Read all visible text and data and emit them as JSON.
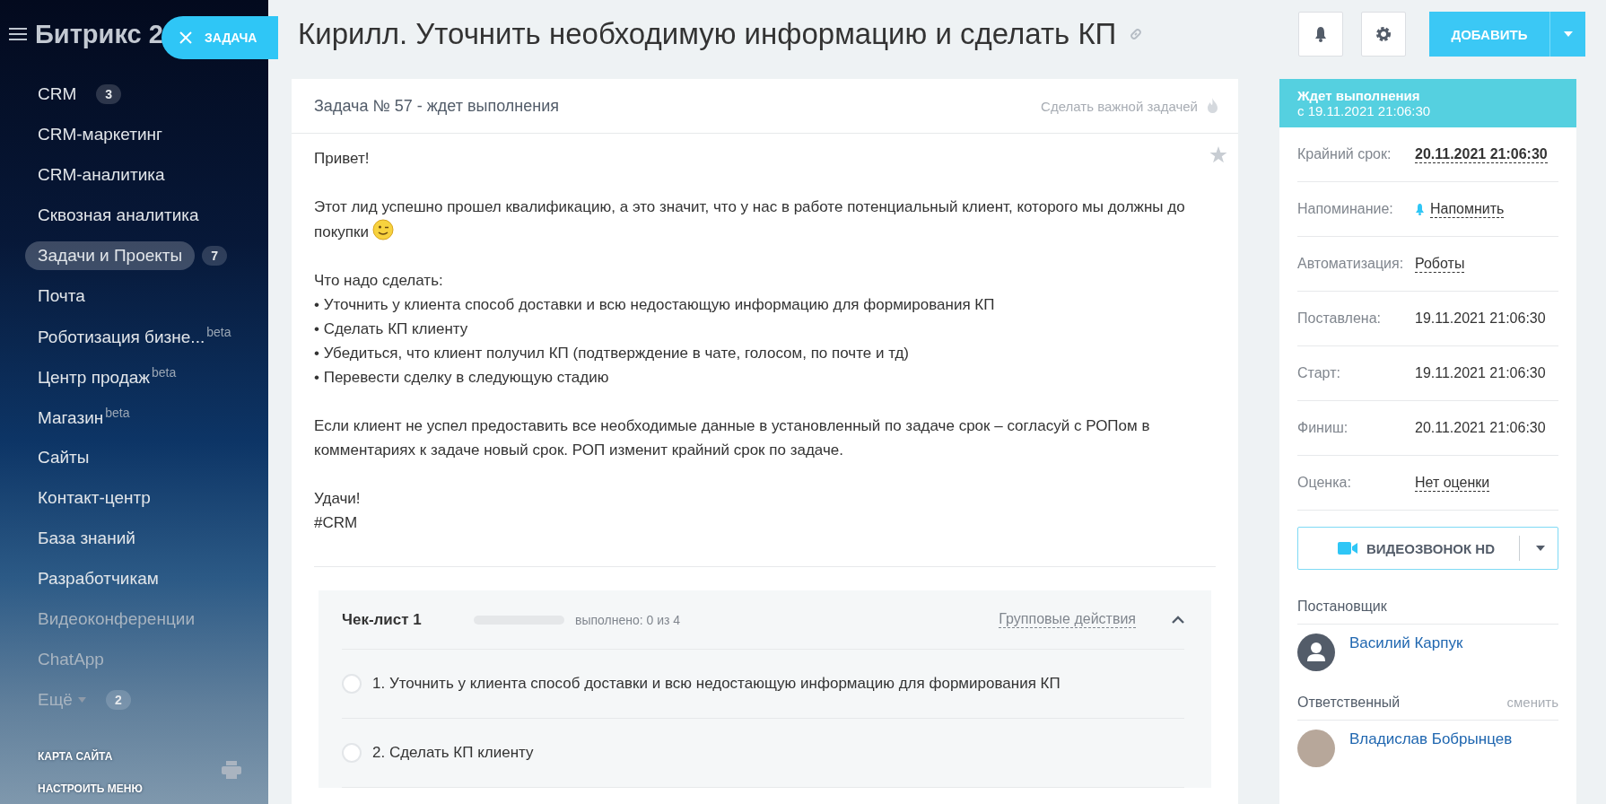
{
  "sidebar": {
    "logo": "Битрикс 2",
    "task_button": "ЗАДАЧА",
    "items": [
      {
        "label": "CRM",
        "counter": "3",
        "selected": false
      },
      {
        "label": "CRM-маркетинг",
        "selected": false
      },
      {
        "label": "CRM-аналитика",
        "selected": false
      },
      {
        "label": "Сквозная аналитика",
        "selected": false
      },
      {
        "label": "Задачи и Проекты",
        "counter": "7",
        "selected": true
      },
      {
        "label": "Почта",
        "selected": false
      },
      {
        "label": "Роботизация бизне...",
        "beta": "beta",
        "selected": false
      },
      {
        "label": "Центр продаж",
        "beta": "beta",
        "selected": false
      },
      {
        "label": "Магазин",
        "beta": "beta",
        "selected": false
      },
      {
        "label": "Сайты",
        "selected": false
      },
      {
        "label": "Контакт-центр",
        "selected": false
      },
      {
        "label": "База знаний",
        "selected": false
      },
      {
        "label": "Разработчикам",
        "selected": false
      },
      {
        "label": "Видеоконференции",
        "selected": false
      },
      {
        "label": "ChatApp",
        "selected": false
      },
      {
        "label": "Ещё",
        "counter": "2",
        "selected": false,
        "dropdown": true
      }
    ],
    "footer": [
      "КАРТА САЙТА",
      "НАСТРОИТЬ МЕНЮ"
    ]
  },
  "header": {
    "title": "Кирилл. Уточнить необходимую информацию и сделать КП",
    "add_button": "ДОБАВИТЬ"
  },
  "task": {
    "heading": "Задача № 57 - ждет выполнения",
    "important_link": "Сделать важной задачей",
    "description": [
      {
        "lines": [
          "Привет!"
        ]
      },
      {
        "lines": [
          "Этот лид успешно прошел квалификацию, а это значит, что у нас в работе потенциальный клиент, которого мы должны до",
          "покупки"
        ],
        "emoji": true
      },
      {
        "lines": [
          "Что надо сделать:",
          "• Уточнить у клиента способ доставки и всю недостающую информацию для формирования КП",
          "• Сделать КП клиенту",
          "• Убедиться, что клиент получил КП (подтверждение в чате, голосом, по почте и тд)",
          "• Перевести сделку в следующую стадию"
        ]
      },
      {
        "lines": [
          "Если клиент не успел предоставить все необходимые данные в установленный по задаче срок – согласуй с РОПом в комментариях к задаче новый срок. РОП изменит крайний срок по задаче."
        ]
      },
      {
        "lines": [
          "Удачи!",
          "#CRM"
        ]
      }
    ],
    "checklist": {
      "title": "Чек-лист 1",
      "level": 0,
      "progress": "выполнено: 0 из 4",
      "group_actions": "Групповые действия",
      "expanded": true,
      "items": [
        {
          "text": "1. Уточнить у клиента способ доставки и всю недостающую информацию для формирования КП",
          "checked": false
        },
        {
          "text": "2. Сделать КП клиенту",
          "checked": false
        }
      ]
    }
  },
  "panel": {
    "status": {
      "title": "Ждет выполнения",
      "since": "с 19.11.2021 21:06:30"
    },
    "fields": [
      {
        "label": "Крайний срок:",
        "value": "20.11.2021 21:06:30",
        "kind": "deadline"
      },
      {
        "label": "Напоминание:",
        "value": "Напомнить",
        "kind": "reminder"
      },
      {
        "label": "Автоматизация:",
        "value": "Роботы",
        "kind": "link"
      },
      {
        "label": "Поставлена:",
        "value": "19.11.2021 21:06:30",
        "kind": "plain"
      },
      {
        "label": "Старт:",
        "value": "19.11.2021 21:06:30",
        "kind": "plain"
      },
      {
        "label": "Финиш:",
        "value": "20.11.2021 21:06:30",
        "kind": "plain"
      },
      {
        "label": "Оценка:",
        "value": "Нет оценки",
        "kind": "link"
      }
    ],
    "video_button": "ВИДЕОЗВОНОК HD",
    "people": [
      {
        "role": "Постановщик",
        "name": "Василий Карпук",
        "kind": "silhouette"
      },
      {
        "role": "Ответственный",
        "action": "сменить",
        "name": "Владислав Бобрынцев",
        "kind": "photo"
      }
    ]
  }
}
